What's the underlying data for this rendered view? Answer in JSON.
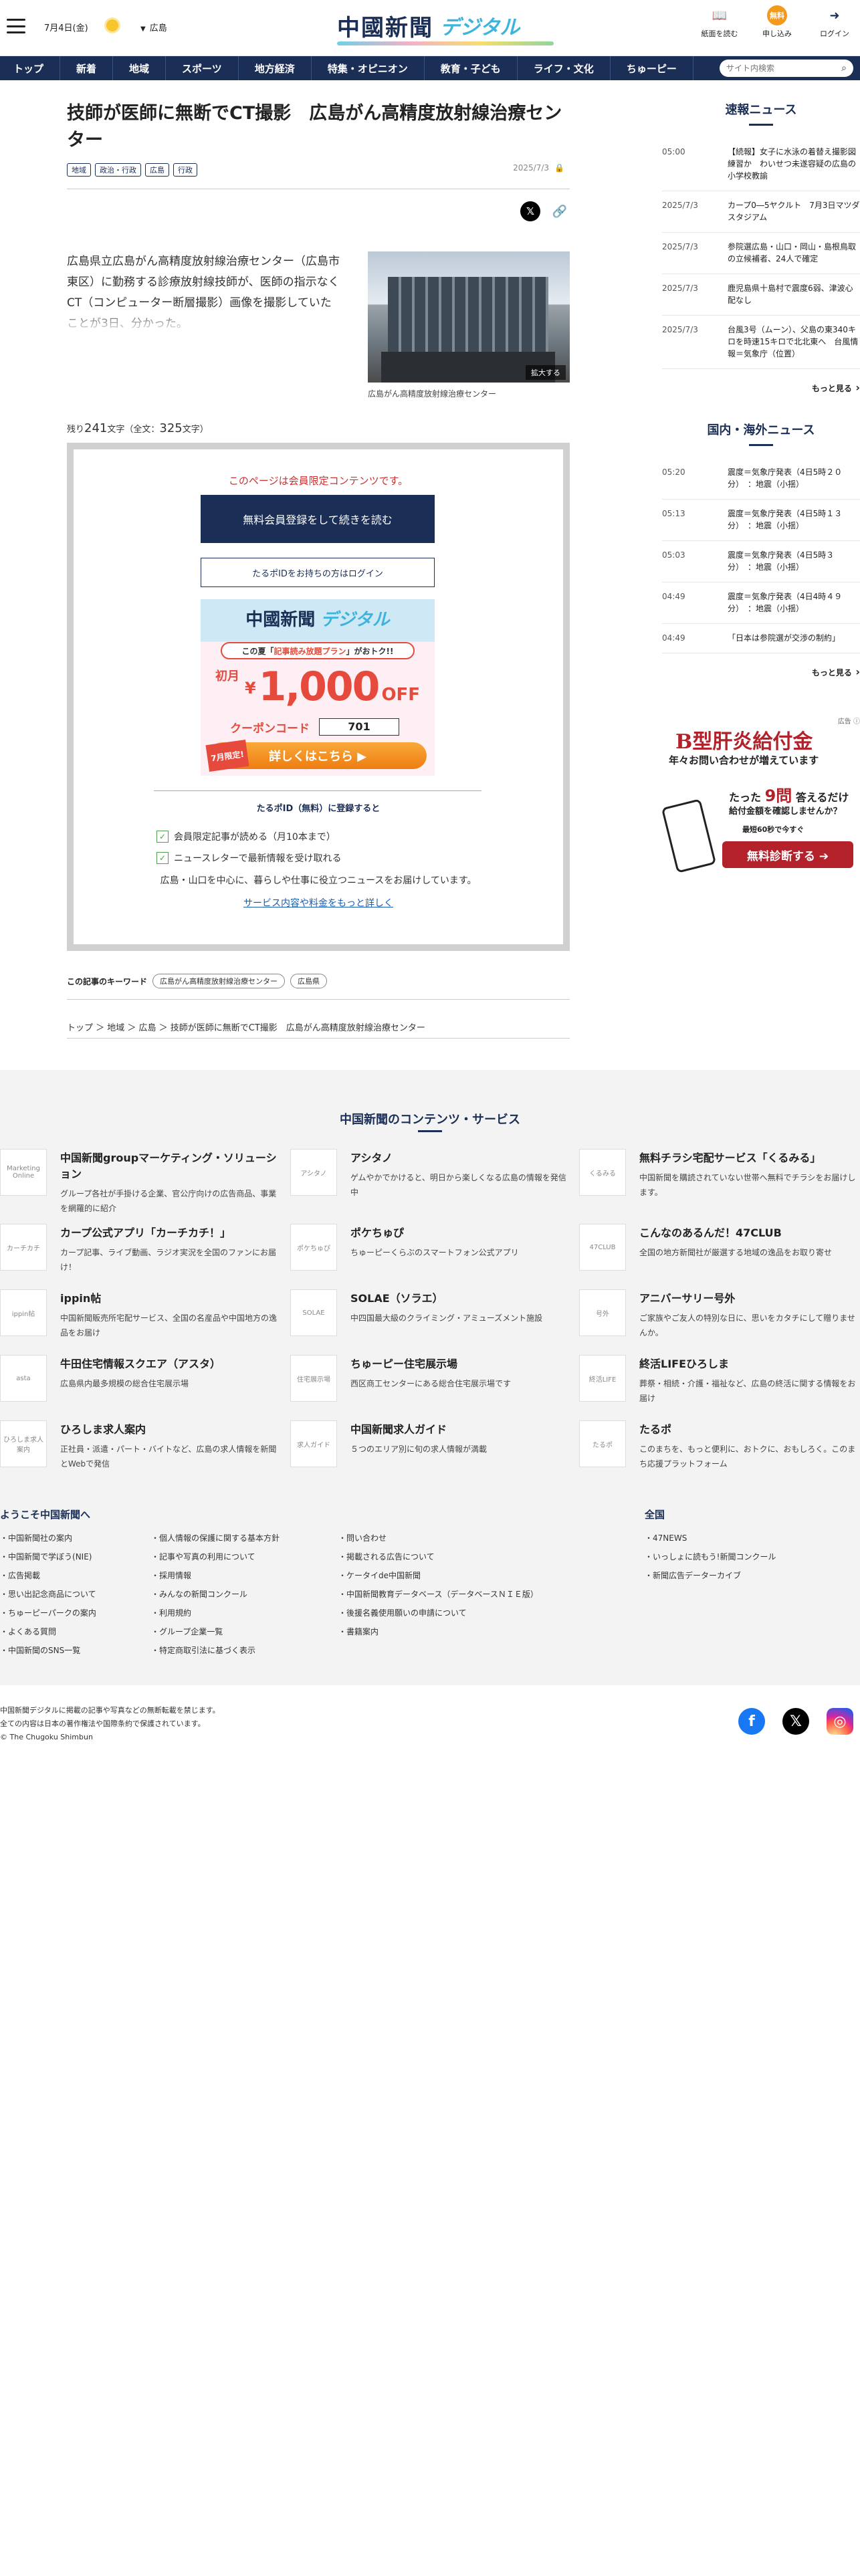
{
  "header": {
    "date": "7月4日(金)",
    "location": "広島",
    "logo_main": "中國新聞",
    "logo_sub": "デジタル",
    "buttons": [
      {
        "label": "紙面を読む",
        "icon": "book-icon"
      },
      {
        "label": "申し込み",
        "icon": "subscribe-icon",
        "badge": "無料"
      },
      {
        "label": "ログイン",
        "icon": "login-icon"
      }
    ]
  },
  "nav": {
    "items": [
      "トップ",
      "新着",
      "地域",
      "スポーツ",
      "地方経済",
      "特集・オピニオン",
      "教育・子ども",
      "ライフ・文化",
      "ちゅーピー"
    ],
    "search_placeholder": "サイト内検索"
  },
  "article": {
    "title": "技師が医師に無断でCT撮影　広島がん高精度放射線治療センター",
    "tags": [
      "地域",
      "政治・行政",
      "広島",
      "行政"
    ],
    "date": "2025/7/3",
    "lead": "広島県立広島がん高精度放射線治療センター（広島市東区）に勤務する診療放射線技師が、医師の指示なくCT（コンピューター断層撮影）画像を撮影していたことが3日、分かった。",
    "photo_zoom": "拡大する",
    "photo_caption": "広島がん高精度放射線治療センター",
    "remain_prefix": "残り",
    "remain_count": "241",
    "remain_mid": "文字（全文：",
    "total_count": "325",
    "remain_suffix": "文字）"
  },
  "paywall": {
    "notice": "このページは会員限定コンテンツです。",
    "register_button": "無料会員登録をして続きを読む",
    "login_button": "たるポIDをお持ちの方はログイン",
    "promo": {
      "logo_main": "中國新聞",
      "logo_sub": "デジタル",
      "banner_pre": "この夏「",
      "banner_em": "記事読み放題プラン",
      "banner_post": "」がおトク!!",
      "month": "初月",
      "yen": "¥",
      "price": "1,000",
      "off": "OFF",
      "coupon_label": "クーポンコード",
      "coupon_code": "701",
      "badge": "7月限定!",
      "cta": "詳しくはこちら ▶"
    },
    "tid_title": "たるポID（無料）に登録すると",
    "benefits": [
      "会員限定記事が読める（月10本まで）",
      "ニュースレターで最新情報を受け取れる"
    ],
    "benefit_note": "広島・山口を中心に、暮らしや仕事に役立つニュースをお届けしています。",
    "benefit_link": "サービス内容や料金をもっと詳しく"
  },
  "keywords": {
    "label": "この記事のキーワード",
    "items": [
      "広島がん高精度放射線治療センター",
      "広島県"
    ]
  },
  "breadcrumb": "トップ ＞ 地域 ＞ 広島 ＞ 技師が医師に無断でCT撮影　広島がん高精度放射線治療センター",
  "sidebar": {
    "news_title": "速報ニュース",
    "news": [
      {
        "time": "05:00",
        "headline": "【続報】女子に水泳の着替え撮影図練習か　わいせつ未遂容疑の広島の小学校教諭"
      },
      {
        "time": "2025/7/3",
        "headline": "カープ0―5ヤクルト　7月3日マツダスタジアム"
      },
      {
        "time": "2025/7/3",
        "headline": "参院選広島・山口・岡山・島根鳥取の立候補者、24人で確定"
      },
      {
        "time": "2025/7/3",
        "headline": "鹿児島県十島村で震度6弱、津波心配なし"
      },
      {
        "time": "2025/7/3",
        "headline": "台風3号（ムーン）、父島の東340キロを時速15キロで北北東へ　台風情報＝気象庁（位置）"
      }
    ],
    "more1": "もっと見る",
    "world_title": "国内・海外ニュース",
    "world": [
      {
        "time": "05:20",
        "headline": "震度＝気象庁発表（4日5時２０分）　：地震（小揺）"
      },
      {
        "time": "05:13",
        "headline": "震度＝気象庁発表（4日5時１３分）　：地震（小揺）"
      },
      {
        "time": "05:03",
        "headline": "震度＝気象庁発表（4日5時３分）　：地震（小揺）"
      },
      {
        "time": "04:49",
        "headline": "震度＝気象庁発表（4日4時４９分）　：地震（小揺）"
      },
      {
        "time": "04:49",
        "headline": "「日本は参院選が交渉の制約」"
      }
    ],
    "more2": "もっと見る",
    "ad": {
      "label": "広告 ⓘ",
      "title": "B型肝炎給付金",
      "sub": "年々お問い合わせが増えています",
      "q_pre": "たった",
      "q_em": "9問",
      "q_post": "答えるだけ",
      "q2": "給付金額を確認しませんか？",
      "q3": "最短60秒で今すぐ",
      "cta": "無料診断する ➔"
    }
  },
  "services": {
    "title": "中国新聞のコンテンツ・サービス",
    "items": [
      {
        "name": "中国新聞groupマーケティング・ソリューション",
        "desc": "グループ各社が手掛ける企業、官公庁向けの広告商品、事業を網羅的に紹介",
        "logo": "Marketing Online"
      },
      {
        "name": "アシタノ",
        "desc": "ゲムやかでかけると、明日から楽しくなる広島の情報を発信中",
        "logo": "アシタノ"
      },
      {
        "name": "無料チラシ宅配サービス「くるみる」",
        "desc": "中国新聞を購読されていない世帯へ無料でチラシをお届けします。",
        "logo": "くるみる"
      },
      {
        "name": "カープ公式アプリ「カーチカチ！」",
        "desc": "カープ記事、ライブ動画、ラジオ実況を全国のファンにお届け！",
        "logo": "カーチカチ"
      },
      {
        "name": "ポケちゅぴ",
        "desc": "ちゅーピーくらぶのスマートフォン公式アプリ",
        "logo": "ポケちゅぴ"
      },
      {
        "name": "こんなのあるんだ！47CLUB",
        "desc": "全国の地方新聞社が厳選する地域の逸品をお取り寄せ",
        "logo": "47CLUB"
      },
      {
        "name": "ippin帖",
        "desc": "中国新聞販売所宅配サービス、全国の名産品や中国地方の逸品をお届け",
        "logo": "ippin帖"
      },
      {
        "name": "SOLAE（ソラエ）",
        "desc": "中四国最大級のクライミング・アミューズメント施設",
        "logo": "SOLAE"
      },
      {
        "name": "アニバーサリー号外",
        "desc": "ご家族やご友人の特別な日に、思いをカタチにして贈りませんか。",
        "logo": "号外"
      },
      {
        "name": "牛田住宅情報スクエア（アスタ）",
        "desc": "広島県内最多規模の総合住宅展示場",
        "logo": "asta"
      },
      {
        "name": "ちゅーピー住宅展示場",
        "desc": "西区商工センターにある総合住宅展示場です",
        "logo": "住宅展示場"
      },
      {
        "name": "終活LIFEひろしま",
        "desc": "葬祭・相続・介護・福祉など、広島の終活に関する情報をお届け",
        "logo": "終活LIFE"
      },
      {
        "name": "ひろしま求人案内",
        "desc": "正社員・派遣・パート・バイトなど、広島の求人情報を新聞とWebで発信",
        "logo": "ひろしま求人案内"
      },
      {
        "name": "中国新聞求人ガイド",
        "desc": "５つのエリア別に旬の求人情報が満載",
        "logo": "求人ガイド"
      },
      {
        "name": "たるポ",
        "desc": "このまちを、もっと便利に、おトクに、おもしろく。このまち応援プラットフォーム",
        "logo": "たるポ"
      }
    ]
  },
  "footer": {
    "welcome": "ようこそ中国新聞へ",
    "col1": [
      "中国新聞社の案内",
      "中国新聞で学ぼう(NIE)",
      "広告掲載",
      "思い出記念商品について",
      "ちゅーピーパークの案内",
      "よくある質問",
      "中国新聞のSNS一覧"
    ],
    "col2": [
      "個人情報の保護に関する基本方針",
      "記事や写真の利用について",
      "採用情報",
      "みんなの新聞コンクール",
      "利用規約",
      "グループ企業一覧",
      "特定商取引法に基づく表示"
    ],
    "col3": [
      "問い合わせ",
      "掲載される広告について",
      "ケータイde中国新聞",
      "中国新聞教育データベース（データベースＮＩＥ版）",
      "後援名義使用願いの申請について",
      "書籍案内"
    ],
    "zenkoku": "全国",
    "col4": [
      "47NEWS",
      "いっしょに読もう!新聞コンクール",
      "新聞広告データーカイブ"
    ],
    "copy1": "中国新聞デジタルに掲載の記事や写真などの無断転載を禁じます。",
    "copy2": "全ての内容は日本の著作権法や国際条約で保護されています。",
    "copy3": "© The Chugoku Shimbun"
  },
  "colors": {
    "navy": "#1b2e55",
    "accent": "#3cb4dc",
    "red": "#c83232",
    "orange": "#f39a1c"
  }
}
